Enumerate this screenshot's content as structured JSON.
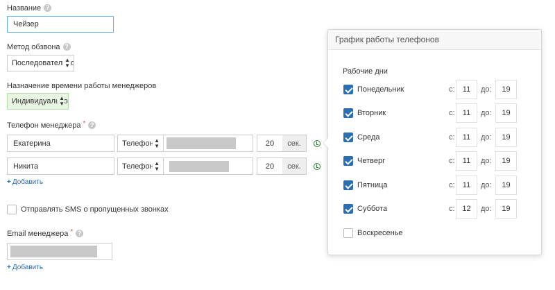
{
  "form": {
    "name": {
      "label": "Название",
      "value": "Чейзер"
    },
    "dial_method": {
      "label": "Метод обзвона",
      "value": "Последовательно"
    },
    "work_time": {
      "label": "Назначение времени работы менеджеров",
      "value": "Индивидуально"
    },
    "manager_phone": {
      "label": "Телефон менеджера",
      "rows": [
        {
          "name": "Екатерина",
          "type": "Телефон",
          "seconds": "20",
          "unit": "сек."
        },
        {
          "name": "Никита",
          "type": "Телефон",
          "seconds": "20",
          "unit": "сек."
        }
      ],
      "add_label": "Добавить"
    },
    "sms": {
      "label": "Отправлять SMS о пропущенных звонках",
      "checked": false
    },
    "manager_email": {
      "label": "Email менеджера",
      "add_label": "Добавить"
    }
  },
  "schedule": {
    "title": "График работы телефонов",
    "section_label": "Рабочие дни",
    "from_label": "с:",
    "to_label": "до:",
    "days": [
      {
        "name": "Понедельник",
        "checked": true,
        "from": "11",
        "to": "19"
      },
      {
        "name": "Вторник",
        "checked": true,
        "from": "11",
        "to": "19"
      },
      {
        "name": "Среда",
        "checked": true,
        "from": "11",
        "to": "19"
      },
      {
        "name": "Четверг",
        "checked": true,
        "from": "11",
        "to": "19"
      },
      {
        "name": "Пятница",
        "checked": true,
        "from": "11",
        "to": "19"
      },
      {
        "name": "Суббота",
        "checked": true,
        "from": "12",
        "to": "19"
      },
      {
        "name": "Воскресенье",
        "checked": false
      }
    ]
  },
  "colors": {
    "accent": "#2a6eb4",
    "required": "#d9534f",
    "clock": "#2e7d32",
    "green_select": "#e8f5e3"
  }
}
